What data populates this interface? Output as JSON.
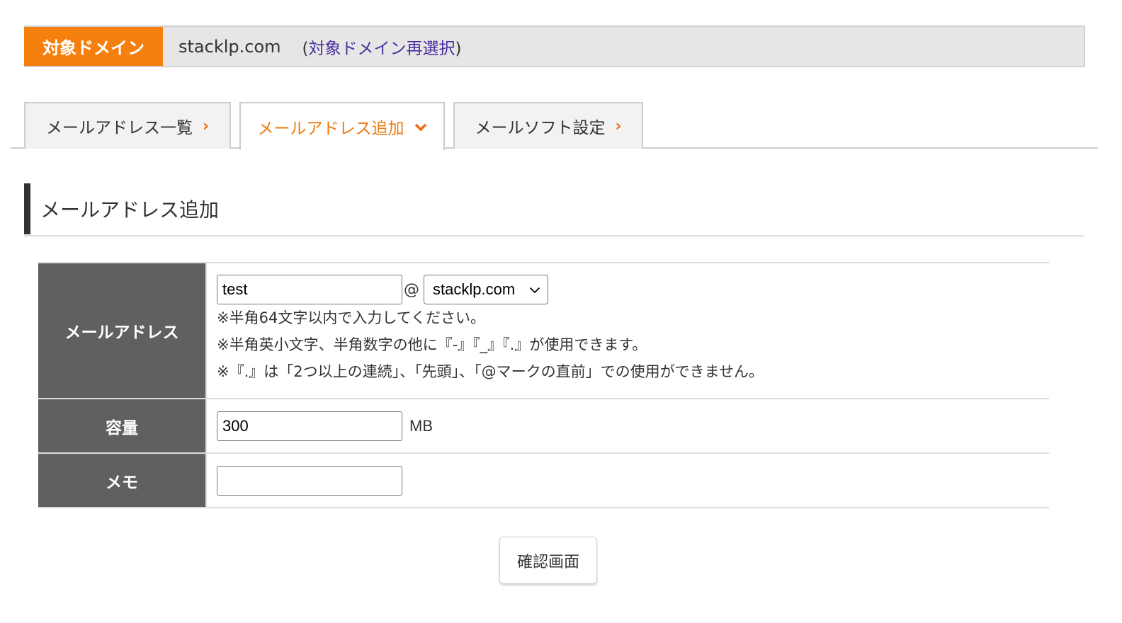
{
  "domain_bar": {
    "label": "対象ドメイン",
    "domain": "stacklp.com",
    "reselect_open": "(",
    "reselect_link": "対象ドメイン再選択",
    "reselect_close": ")"
  },
  "tabs": [
    {
      "label": "メールアドレス一覧",
      "icon": "chevron-right-icon",
      "active": false
    },
    {
      "label": "メールアドレス追加",
      "icon": "chevron-down-icon",
      "active": true
    },
    {
      "label": "メールソフト設定",
      "icon": "chevron-right-icon",
      "active": false
    }
  ],
  "section": {
    "title": "メールアドレス追加"
  },
  "form": {
    "email": {
      "label": "メールアドレス",
      "value": "test",
      "at": "@",
      "domain_selected": "stacklp.com",
      "notes": [
        "※半角64文字以内で入力してください。",
        "※半角英小文字、半角数字の他に『-』『_』『.』が使用できます。",
        "※『.』は「2つ以上の連続」、「先頭」、「@マークの直前」での使用ができません。"
      ]
    },
    "capacity": {
      "label": "容量",
      "value": "300",
      "unit": "MB"
    },
    "memo": {
      "label": "メモ",
      "value": ""
    }
  },
  "confirm_button": "確認画面",
  "colors": {
    "accent_orange": "#f6800e",
    "active_tab_text": "#ee7a10",
    "link_purple": "#4b2fa0",
    "table_header": "#606060"
  }
}
